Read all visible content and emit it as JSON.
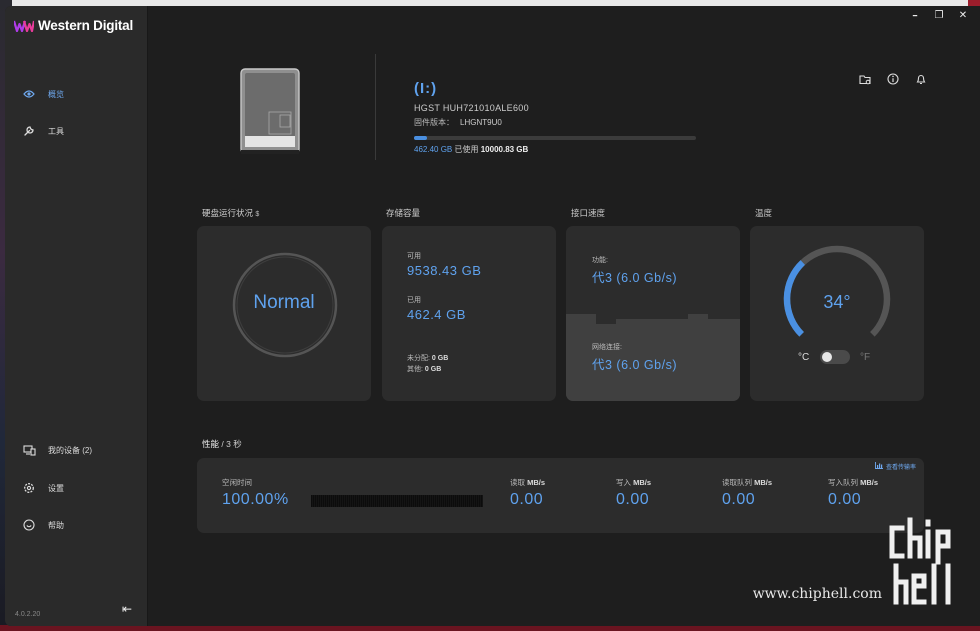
{
  "app": {
    "brand": "Western Digital",
    "version": "4.0.2.20",
    "window_controls": {
      "minimize": "━",
      "maximize": "❐",
      "close": "✕"
    }
  },
  "sidebar": {
    "items": [
      {
        "label": "概览",
        "icon": "eye-icon",
        "active": true
      },
      {
        "label": "工具",
        "icon": "wrench-icon",
        "active": false
      }
    ],
    "bottom_items": [
      {
        "label": "我的设备 (2)",
        "icon": "devices-icon"
      },
      {
        "label": "设置",
        "icon": "gear-icon"
      },
      {
        "label": "帮助",
        "icon": "help-icon"
      }
    ],
    "collapse_icon": "collapse-left-icon"
  },
  "drive": {
    "letter": "(I:)",
    "model": "HGST HUH721010ALE600",
    "firmware_label": "固件版本：",
    "firmware": "LHGNT9U0",
    "used": "462.40 GB",
    "used_suffix": "已使用",
    "total": "10000.83 GB",
    "used_fraction": 0.046
  },
  "header_icons": [
    "folder-icon",
    "info-icon",
    "bell-icon"
  ],
  "sections": {
    "health": {
      "label": "硬盘运行状况",
      "status": "Normal",
      "help_icon": "help-circle-icon"
    },
    "storage": {
      "label": "存储容量",
      "available_label": "可用",
      "available": "9538.43 GB",
      "used_label": "已用",
      "used": "462.4 GB",
      "unallocated_label": "未分配:",
      "unallocated": "0 GB",
      "other_label": "其他:",
      "other": "0 GB"
    },
    "interface": {
      "label": "接口速度",
      "capability_label": "功能:",
      "capability": "代3 (6.0 Gb/s)",
      "link_label": "网络连接:",
      "link": "代3 (6.0 Gb/s)"
    },
    "temperature": {
      "label": "温度",
      "value": "34°",
      "unit_c": "°C",
      "unit_f": "°F",
      "gauge_fraction": 0.34,
      "unit_is_fahrenheit": false
    }
  },
  "performance": {
    "label": "性能",
    "interval": "/ 3 秒",
    "link": "查看传输率",
    "idle_label": "空闲时间",
    "idle_value": "100.00%",
    "metrics": [
      {
        "label": "读取",
        "unit": "MB/s",
        "value": "0.00"
      },
      {
        "label": "写入",
        "unit": "MB/s",
        "value": "0.00"
      },
      {
        "label": "读取队列",
        "unit": "MB/s",
        "value": "0.00"
      },
      {
        "label": "写入队列",
        "unit": "MB/s",
        "value": "0.00"
      }
    ]
  },
  "watermark": {
    "text": "www.chiphell.com"
  }
}
